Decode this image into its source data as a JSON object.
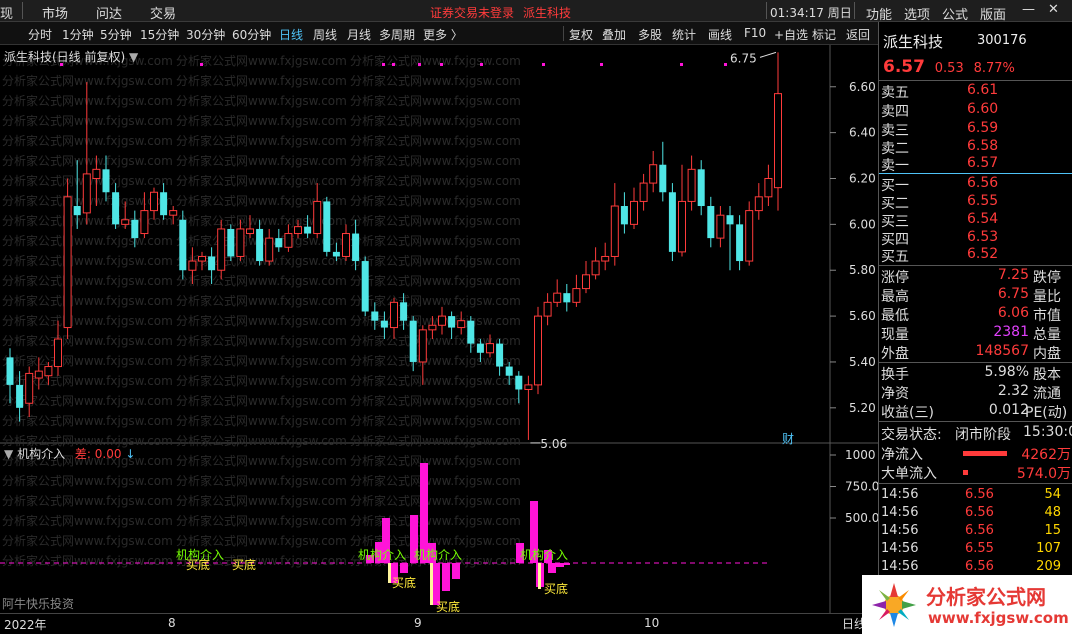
{
  "menubar": {
    "items": [
      "现",
      "市场",
      "问达",
      "交易"
    ],
    "notice": "证券交易未登录",
    "stock_link": "派生科技",
    "clock": "01:34:17 周日",
    "right_items": [
      "功能",
      "选项",
      "公式",
      "版面"
    ],
    "win_min": "—",
    "win_close": "✕"
  },
  "periodbar": {
    "periods": [
      "分时",
      "1分钟",
      "5分钟",
      "15分钟",
      "30分钟",
      "60分钟",
      "日线",
      "周线",
      "月线",
      "多周期",
      "更多 〉"
    ],
    "active": "日线",
    "tools": [
      "复权",
      "叠加",
      "多股",
      "统计",
      "画线",
      "F10",
      "+自选",
      "标记",
      "返回"
    ]
  },
  "main_chart": {
    "title": "派生科技(日线 前复权)",
    "max_label": "6.75",
    "min_label": "5.06",
    "badge": "财",
    "price_ticks": [
      "6.60",
      "6.40",
      "6.20",
      "6.00",
      "5.80",
      "5.60",
      "5.40",
      "5.20"
    ]
  },
  "indicator": {
    "name": "机构介入",
    "diff_label": "差: 0.00",
    "down_arrow": "↓",
    "vol_ticks": [
      "1000",
      "750.0",
      "500.0"
    ],
    "buy_labels": [
      "买底",
      "买底",
      "买底",
      "买底",
      "买底"
    ],
    "entry_labels": [
      "机构介入",
      "机构介入",
      "机构介入",
      "机构介入"
    ]
  },
  "date_axis": {
    "labels": [
      "2022年",
      "8",
      "9",
      "10"
    ],
    "tab": "日线"
  },
  "watermark": "阿牛快乐投资",
  "watermark_repeat": "分析家公式网www.fxjgsw.com",
  "quote": {
    "name": "派生科技",
    "code": "300176",
    "price": "6.57",
    "change": "0.53",
    "pct": "8.77%",
    "asks": [
      {
        "label": "卖五",
        "price": "6.61"
      },
      {
        "label": "卖四",
        "price": "6.60"
      },
      {
        "label": "卖三",
        "price": "6.59"
      },
      {
        "label": "卖二",
        "price": "6.58"
      },
      {
        "label": "卖一",
        "price": "6.57"
      }
    ],
    "bids": [
      {
        "label": "买一",
        "price": "6.56"
      },
      {
        "label": "买二",
        "price": "6.55"
      },
      {
        "label": "买三",
        "price": "6.54"
      },
      {
        "label": "买四",
        "price": "6.53"
      },
      {
        "label": "买五",
        "price": "6.52"
      }
    ],
    "stats": [
      {
        "l1": "涨停",
        "v": "7.25",
        "l2": "跌停",
        "color": "#ff3b3b"
      },
      {
        "l1": "最高",
        "v": "6.75",
        "l2": "量比",
        "color": "#ff3b3b"
      },
      {
        "l1": "最低",
        "v": "6.06",
        "l2": "市值",
        "color": "#ff3b3b"
      },
      {
        "l1": "现量",
        "v": "2381",
        "l2": "总量",
        "color": "#e040fb"
      },
      {
        "l1": "外盘",
        "v": "148567",
        "l2": "内盘",
        "color": "#ff3b3b"
      }
    ],
    "stats2": [
      {
        "l1": "换手",
        "v": "5.98%",
        "l2": "股本",
        "color": "#ddd"
      },
      {
        "l1": "净资",
        "v": "2.32",
        "l2": "流通",
        "color": "#ddd"
      },
      {
        "l1": "收益(三)",
        "v": "0.012",
        "l2": "PE(动)",
        "color": "#ddd"
      }
    ],
    "trade_status_label": "交易状态:",
    "trade_status": "闭市阶段",
    "trade_time": "15:30:0",
    "net_inflow_label": "净流入",
    "net_inflow": "4262万",
    "big_inflow_label": "大单流入",
    "big_inflow": "574.0万",
    "ticks": [
      {
        "time": "14:56",
        "price": "6.56",
        "vol": "54"
      },
      {
        "time": "14:56",
        "price": "6.56",
        "vol": "48"
      },
      {
        "time": "14:56",
        "price": "6.56",
        "vol": "15"
      },
      {
        "time": "14:56",
        "price": "6.55",
        "vol": "107"
      },
      {
        "time": "14:56",
        "price": "6.56",
        "vol": "209"
      }
    ]
  },
  "logo": {
    "text": "分析家公式网",
    "url": "www.fxjgsw.com"
  },
  "colors": {
    "up": "#ff3b3b",
    "down": "#4fe6e6",
    "accent": "#4fc3f7",
    "magenta": "#ff14d8"
  },
  "chart_data": {
    "type": "candlestick",
    "price_range": [
      5.06,
      6.75
    ],
    "candles": [
      [
        5.42,
        5.3,
        5.46,
        5.22
      ],
      [
        5.3,
        5.2,
        5.36,
        5.14
      ],
      [
        5.22,
        5.35,
        5.38,
        5.16
      ],
      [
        5.33,
        5.36,
        5.42,
        5.28
      ],
      [
        5.34,
        5.38,
        5.4,
        5.3
      ],
      [
        5.38,
        5.5,
        5.58,
        5.34
      ],
      [
        5.55,
        6.12,
        6.2,
        5.5
      ],
      [
        6.08,
        6.04,
        6.28,
        5.98
      ],
      [
        6.05,
        6.22,
        6.62,
        6.0
      ],
      [
        6.2,
        6.24,
        6.3,
        6.08
      ],
      [
        6.24,
        6.14,
        6.3,
        6.1
      ],
      [
        6.14,
        6.0,
        6.18,
        5.98
      ],
      [
        6.0,
        6.02,
        6.1,
        5.98
      ],
      [
        6.02,
        5.94,
        6.06,
        5.9
      ],
      [
        5.96,
        6.06,
        6.14,
        5.94
      ],
      [
        6.06,
        6.14,
        6.16,
        6.02
      ],
      [
        6.14,
        6.04,
        6.18,
        6.02
      ],
      [
        6.04,
        6.06,
        6.08,
        6.0
      ],
      [
        6.02,
        5.8,
        6.06,
        5.76
      ],
      [
        5.8,
        5.84,
        5.9,
        5.74
      ],
      [
        5.84,
        5.86,
        5.88,
        5.8
      ],
      [
        5.86,
        5.8,
        5.9,
        5.74
      ],
      [
        5.8,
        5.98,
        6.02,
        5.76
      ],
      [
        5.98,
        5.86,
        6.0,
        5.84
      ],
      [
        5.86,
        5.98,
        6.02,
        5.84
      ],
      [
        5.96,
        5.98,
        6.04,
        5.94
      ],
      [
        5.98,
        5.84,
        6.02,
        5.82
      ],
      [
        5.84,
        5.94,
        5.98,
        5.82
      ],
      [
        5.94,
        5.9,
        5.98,
        5.88
      ],
      [
        5.9,
        5.96,
        6.0,
        5.88
      ],
      [
        5.96,
        5.99,
        6.02,
        5.94
      ],
      [
        5.99,
        5.96,
        6.04,
        5.94
      ],
      [
        5.96,
        6.1,
        6.18,
        5.94
      ],
      [
        6.1,
        5.88,
        6.12,
        5.86
      ],
      [
        5.88,
        5.86,
        5.92,
        5.84
      ],
      [
        5.86,
        5.96,
        6.0,
        5.84
      ],
      [
        5.96,
        5.84,
        6.02,
        5.8
      ],
      [
        5.84,
        5.62,
        5.86,
        5.6
      ],
      [
        5.62,
        5.58,
        5.66,
        5.54
      ],
      [
        5.58,
        5.55,
        5.62,
        5.5
      ],
      [
        5.55,
        5.66,
        5.68,
        5.5
      ],
      [
        5.66,
        5.58,
        5.7,
        5.54
      ],
      [
        5.58,
        5.4,
        5.6,
        5.36
      ],
      [
        5.4,
        5.54,
        5.56,
        5.3
      ],
      [
        5.54,
        5.56,
        5.6,
        5.5
      ],
      [
        5.56,
        5.6,
        5.64,
        5.52
      ],
      [
        5.6,
        5.55,
        5.62,
        5.5
      ],
      [
        5.55,
        5.58,
        5.62,
        5.52
      ],
      [
        5.58,
        5.48,
        5.6,
        5.44
      ],
      [
        5.48,
        5.44,
        5.5,
        5.4
      ],
      [
        5.44,
        5.48,
        5.52,
        5.42
      ],
      [
        5.48,
        5.38,
        5.5,
        5.34
      ],
      [
        5.38,
        5.34,
        5.4,
        5.3
      ],
      [
        5.34,
        5.28,
        5.36,
        5.22
      ],
      [
        5.28,
        5.3,
        5.34,
        5.06
      ],
      [
        5.3,
        5.6,
        5.64,
        5.26
      ],
      [
        5.6,
        5.66,
        5.7,
        5.56
      ],
      [
        5.66,
        5.7,
        5.76,
        5.64
      ],
      [
        5.7,
        5.66,
        5.74,
        5.62
      ],
      [
        5.66,
        5.72,
        5.78,
        5.64
      ],
      [
        5.72,
        5.78,
        5.84,
        5.7
      ],
      [
        5.78,
        5.84,
        5.9,
        5.76
      ],
      [
        5.84,
        5.86,
        5.92,
        5.8
      ],
      [
        5.86,
        6.08,
        6.18,
        5.82
      ],
      [
        6.08,
        6.0,
        6.14,
        5.96
      ],
      [
        6.0,
        6.1,
        6.16,
        5.98
      ],
      [
        6.1,
        6.18,
        6.22,
        6.06
      ],
      [
        6.18,
        6.26,
        6.32,
        6.14
      ],
      [
        6.26,
        6.14,
        6.36,
        6.1
      ],
      [
        6.14,
        5.88,
        6.18,
        5.84
      ],
      [
        5.88,
        6.1,
        6.26,
        5.86
      ],
      [
        6.1,
        6.24,
        6.3,
        6.06
      ],
      [
        6.24,
        6.08,
        6.28,
        6.04
      ],
      [
        6.08,
        5.94,
        6.12,
        5.9
      ],
      [
        5.94,
        6.04,
        6.08,
        5.9
      ],
      [
        6.04,
        6.0,
        6.08,
        5.8
      ],
      [
        6.0,
        5.84,
        6.04,
        5.8
      ],
      [
        5.84,
        6.06,
        6.1,
        5.82
      ],
      [
        6.06,
        6.12,
        6.18,
        6.02
      ],
      [
        6.12,
        6.2,
        6.26,
        6.08
      ],
      [
        6.16,
        6.57,
        6.75,
        6.06
      ]
    ]
  }
}
